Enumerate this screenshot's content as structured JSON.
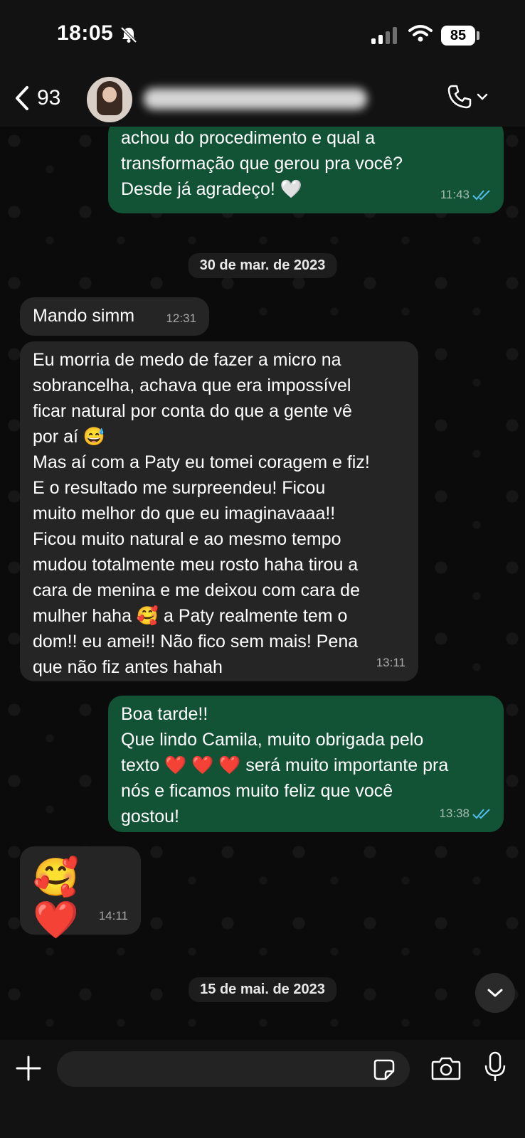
{
  "status": {
    "time": "18:05",
    "battery": "85"
  },
  "header": {
    "back_count": "93",
    "contact_name": "Camila Nascimento Reis"
  },
  "messages": [
    {
      "direction": "out",
      "text": "achou do procedimento e qual a\ntransformação que gerou pra você?\nDesde já agradeço! 🤍",
      "time": "11:43"
    },
    {
      "type": "date",
      "text": "30 de mar. de 2023"
    },
    {
      "direction": "in",
      "text": "Mando simm",
      "time": "12:31"
    },
    {
      "direction": "in",
      "text": "Eu morria de medo de fazer a micro na\nsobrancelha, achava que era impossível\nficar natural por conta do que a gente vê\npor aí 😅\nMas aí com a Paty eu tomei coragem e fiz!\nE o resultado me surpreendeu! Ficou\nmuito melhor do que eu imaginavaaa!!\nFicou muito natural e ao mesmo tempo\nmudou totalmente meu rosto haha tirou a\ncara de menina e me deixou com cara de\nmulher haha 🥰 a Paty realmente tem o\ndom!! eu amei!! Não fico sem mais! Pena\nque não fiz antes hahah",
      "time": "13:11"
    },
    {
      "direction": "out",
      "text": "Boa tarde!!\nQue lindo Camila, muito obrigada pelo\ntexto ❤️ ❤️ ❤️ será muito importante pra\nnós e ficamos muito feliz que você\ngostou!",
      "time": "13:38"
    },
    {
      "direction": "in",
      "text": "🥰 ❤️",
      "time": "14:11"
    },
    {
      "type": "date",
      "text": "15 de mai. de 2023"
    }
  ],
  "colors": {
    "outgoing_bubble": "#125336",
    "incoming_bubble": "#252525",
    "read_ticks": "#53bdeb"
  }
}
